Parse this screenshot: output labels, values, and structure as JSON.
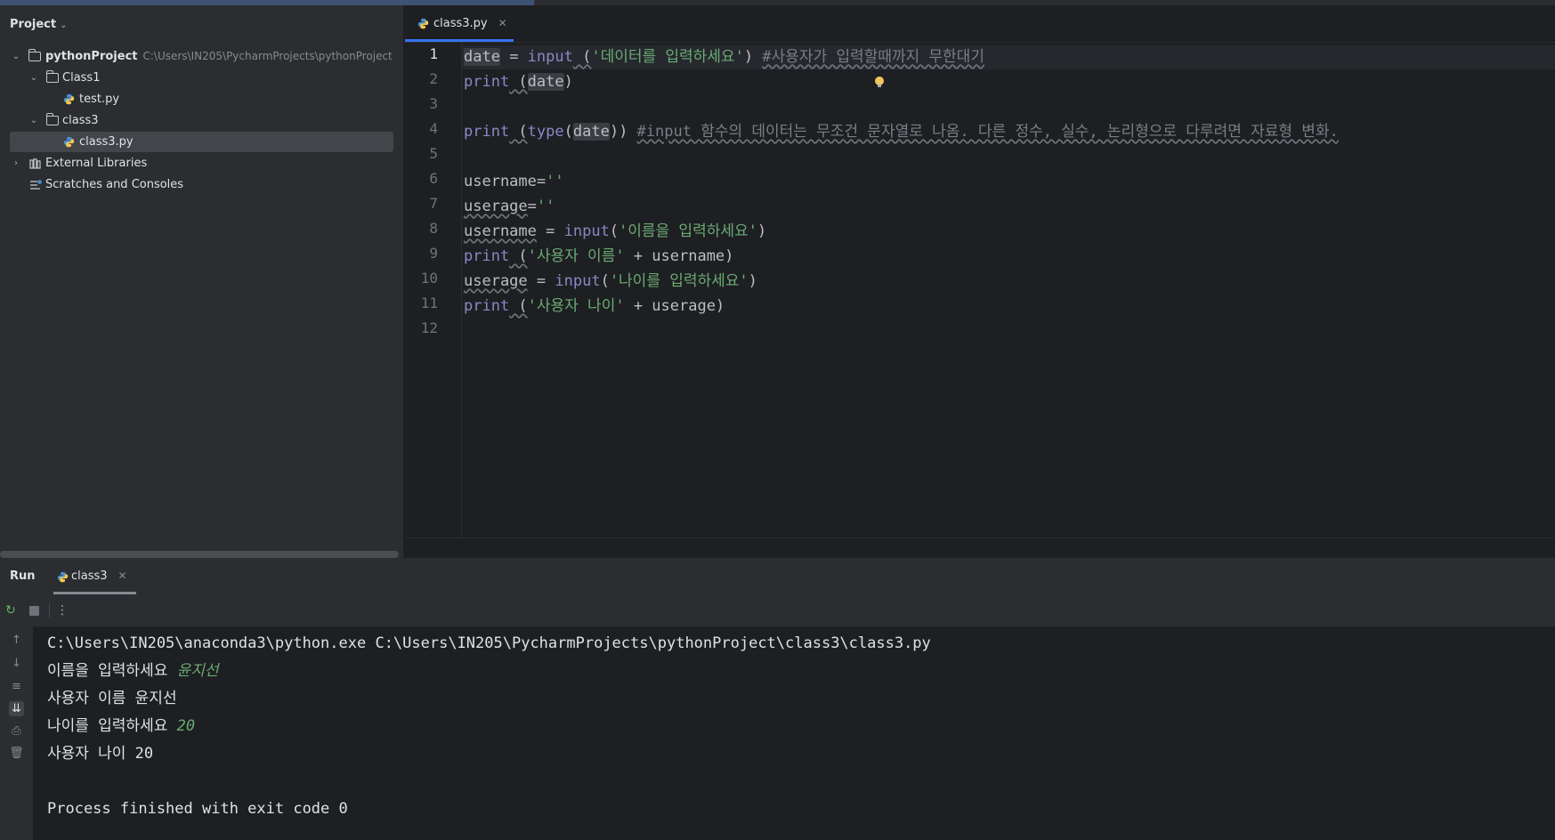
{
  "project_panel": {
    "header": "Project",
    "tree": [
      {
        "label": "pythonProject",
        "path": "C:\\Users\\IN205\\PycharmProjects\\pythonProject"
      },
      {
        "label": "Class1"
      },
      {
        "label": "test.py"
      },
      {
        "label": "class3"
      },
      {
        "label": "class3.py"
      },
      {
        "label": "External Libraries"
      },
      {
        "label": "Scratches and Consoles"
      }
    ]
  },
  "editor": {
    "tab_label": "class3.py",
    "line_numbers": [
      "1",
      "2",
      "3",
      "4",
      "5",
      "6",
      "7",
      "8",
      "9",
      "10",
      "11",
      "12"
    ],
    "lines": {
      "l1_var": "date",
      "l1_eq": " = ",
      "l1_fn": "input",
      "l1_paren": " (",
      "l1_str": "'데이터를 입력하세요'",
      "l1_close": ") ",
      "l1_cmt": "#사용자가 입력할때까지 무한대기",
      "l2_fn": "print",
      "l2_open": " (",
      "l2_var": "date",
      "l2_close": ")",
      "l4_fn": "print",
      "l4_open": " (",
      "l4_type": "type",
      "l4_p": "(",
      "l4_var": "date",
      "l4_close": ")) ",
      "l4_cmt": "#input 함수의 데이터는 무조건 문자열로 나옴. 다른 정수, 실수, 논리형으로 다루려면 자료형 변화.",
      "l6_var": "username",
      "l6_eq": "=",
      "l6_str": "''",
      "l7_var": "userage",
      "l7_eq": "=",
      "l7_str": "''",
      "l8_var": "username",
      "l8_eq": " = ",
      "l8_fn": "input",
      "l8_p": "(",
      "l8_str": "'이름을 입력하세요'",
      "l8_close": ")",
      "l9_fn": "print",
      "l9_p": " (",
      "l9_str": "'사용자 이름'",
      "l9_rest": " + username)",
      "l10_var": "userage",
      "l10_eq": " = ",
      "l10_fn": "input",
      "l10_p": "(",
      "l10_str": "'나이를 입력하세요'",
      "l10_close": ")",
      "l11_fn": "print",
      "l11_p": " (",
      "l11_str": "'사용자 나이'",
      "l11_rest": " + userage)"
    }
  },
  "run_panel": {
    "title": "Run",
    "tab_label": "class3",
    "console": {
      "cmd": "C:\\Users\\IN205\\anaconda3\\python.exe C:\\Users\\IN205\\PycharmProjects\\pythonProject\\class3\\class3.py",
      "prompt1": "이름을 입력하세요 ",
      "input1": "윤지선",
      "out1": "사용자 이름 윤지선",
      "prompt2": "나이를 입력하세요 ",
      "input2": "20",
      "out2": "사용자 나이 20",
      "exit": "Process finished with exit code 0"
    }
  },
  "colors": {
    "accent": "#3574f0",
    "string": "#6aab73",
    "keyword": "#a9b7f6",
    "comment": "#7a7e85"
  }
}
